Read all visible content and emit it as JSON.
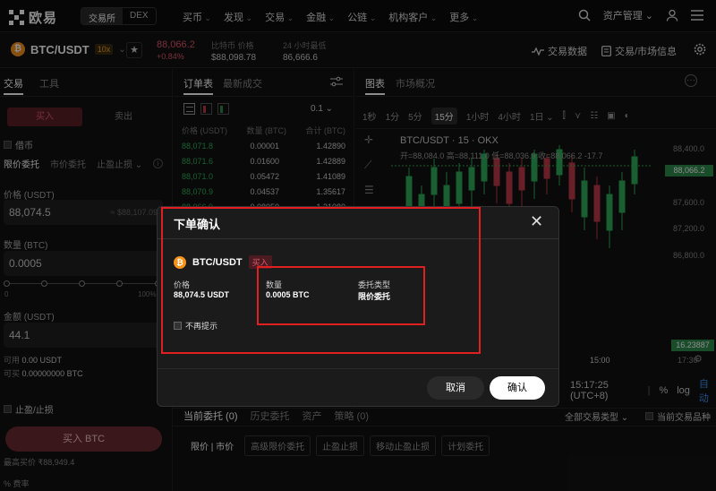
{
  "nav": {
    "logo_text": "欧易",
    "seg": [
      "交易所",
      "DEX"
    ],
    "menu": [
      "买币",
      "发现",
      "交易",
      "金融",
      "公链",
      "机构客户",
      "更多"
    ],
    "asset_mgmt": "资产管理"
  },
  "ticker": {
    "coin_glyph": "₿",
    "pair": "BTC/USDT",
    "leverage": "10x",
    "price": "88,066.2",
    "change": "+0.84%",
    "stat1_label": "比特币 价格",
    "stat1_value": "$88,098.78",
    "stat2_label": "24 小时最低",
    "stat2_value": "86,666.6",
    "trade_data": "交易数据",
    "market_info": "交易/市场信息"
  },
  "left": {
    "tab_trade": "交易",
    "tab_tools": "工具",
    "buy": "买入",
    "sell": "卖出",
    "borrow": "借币",
    "order_types": [
      "限价委托",
      "市价委托",
      "止盈止损"
    ],
    "price_label": "价格 (USDT)",
    "price_value": "88,074.5",
    "price_hint": "≈ $88,107.09",
    "qty_label": "数量 (BTC)",
    "qty_value": "0.0005",
    "slider_min": "0",
    "slider_max": "100%",
    "amount_label": "金额 (USDT)",
    "amount_value": "44.1",
    "avail_label": "可用",
    "avail_value": "0.00 USDT",
    "buyable_label": "可买",
    "buyable_value": "0.00000000 BTC",
    "tpsl": "止盈/止损",
    "buy_btn": "买入 BTC",
    "max_buy_label": "最高买价",
    "max_buy_value": "₹88,949.4",
    "fee": "% 费率"
  },
  "orderbook": {
    "tab1": "订单表",
    "tab2": "最新成交",
    "precision": "0.1",
    "headers": [
      "价格 (USDT)",
      "数量 (BTC)",
      "合计 (BTC)"
    ],
    "rows": [
      [
        "88,071.8",
        "0.00001",
        "1.42890"
      ],
      [
        "88,071.6",
        "0.01600",
        "1.42889"
      ],
      [
        "88,071.0",
        "0.05472",
        "1.41089"
      ],
      [
        "88,070.9",
        "0.04537",
        "1.35617"
      ],
      [
        "88,066.0",
        "0.08050",
        "1.31080"
      ]
    ]
  },
  "chart": {
    "tab1": "图表",
    "tab2": "市场概况",
    "intervals": [
      "1秒",
      "1分",
      "5分",
      "15分",
      "1小时",
      "4小时",
      "1日"
    ],
    "active_interval": "15分",
    "title": "BTC/USDT · 15 · OKX",
    "ohlc": "开=88,084.0 高=88,111.0 低=88,036.9 收=88,066.2 -17.7",
    "y_ticks": [
      "88,400.0",
      "87,600.0",
      "87,200.0",
      "86,800.0"
    ],
    "current_price": "88,066.2",
    "last_tag": "16.23887",
    "x_tick": "15:00",
    "x_tick2": "17:30",
    "time": "15:17:25 (UTC+8)",
    "pct": "%",
    "log": "log",
    "auto": "自动"
  },
  "bottom": {
    "tabs": [
      "当前委托 (0)",
      "历史委托",
      "资产",
      "策略 (0)"
    ],
    "filter": "全部交易类型",
    "current_only": "当前交易品种",
    "subtabs": [
      "限价 | 市价",
      "高级限价委托",
      "止盈止损",
      "移动止盈止损",
      "计划委托"
    ]
  },
  "modal": {
    "title": "下单确认",
    "coin_glyph": "₿",
    "pair": "BTC/USDT",
    "side": "买入",
    "price_label": "价格",
    "price_value": "88,074.5 USDT",
    "qty_label": "数量",
    "qty_value": "0.0005 BTC",
    "type_label": "委托类型",
    "type_value": "限价委托",
    "no_remind": "不再提示",
    "cancel": "取消",
    "confirm": "确认"
  }
}
